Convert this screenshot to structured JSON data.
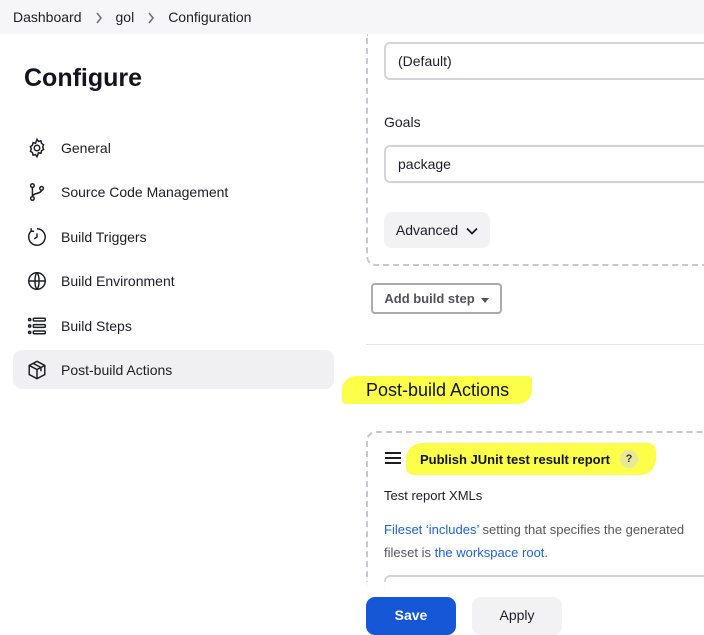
{
  "breadcrumb": {
    "items": [
      "Dashboard",
      "gol",
      "Configuration"
    ]
  },
  "sidebar": {
    "title": "Configure",
    "items": [
      {
        "label": "General",
        "icon": "gear-icon"
      },
      {
        "label": "Source Code Management",
        "icon": "branch-icon"
      },
      {
        "label": "Build Triggers",
        "icon": "timer-icon"
      },
      {
        "label": "Build Environment",
        "icon": "globe-icon"
      },
      {
        "label": "Build Steps",
        "icon": "list-icon"
      },
      {
        "label": "Post-build Actions",
        "icon": "package-icon",
        "active": true
      }
    ]
  },
  "build_step": {
    "version_value": "(Default)",
    "goals_label": "Goals",
    "goals_value": "package",
    "advanced_label": "Advanced",
    "add_build_step_label": "Add build step"
  },
  "post_build": {
    "section_title": "Post-build Actions",
    "publisher_title": "Publish JUnit test result report",
    "help_label": "?",
    "test_report_label": "Test report XMLs",
    "desc_part1": "Fileset ",
    "desc_link1": "‘includes’",
    "desc_part2": " setting that specifies the generated",
    "desc_part3": "fileset is ",
    "desc_link2": "the workspace root",
    "desc_part4": "."
  },
  "actions": {
    "save_label": "Save",
    "apply_label": "Apply"
  },
  "colors": {
    "highlight": "#fbff4a",
    "primary": "#1557d6",
    "link": "#1f62c9"
  }
}
